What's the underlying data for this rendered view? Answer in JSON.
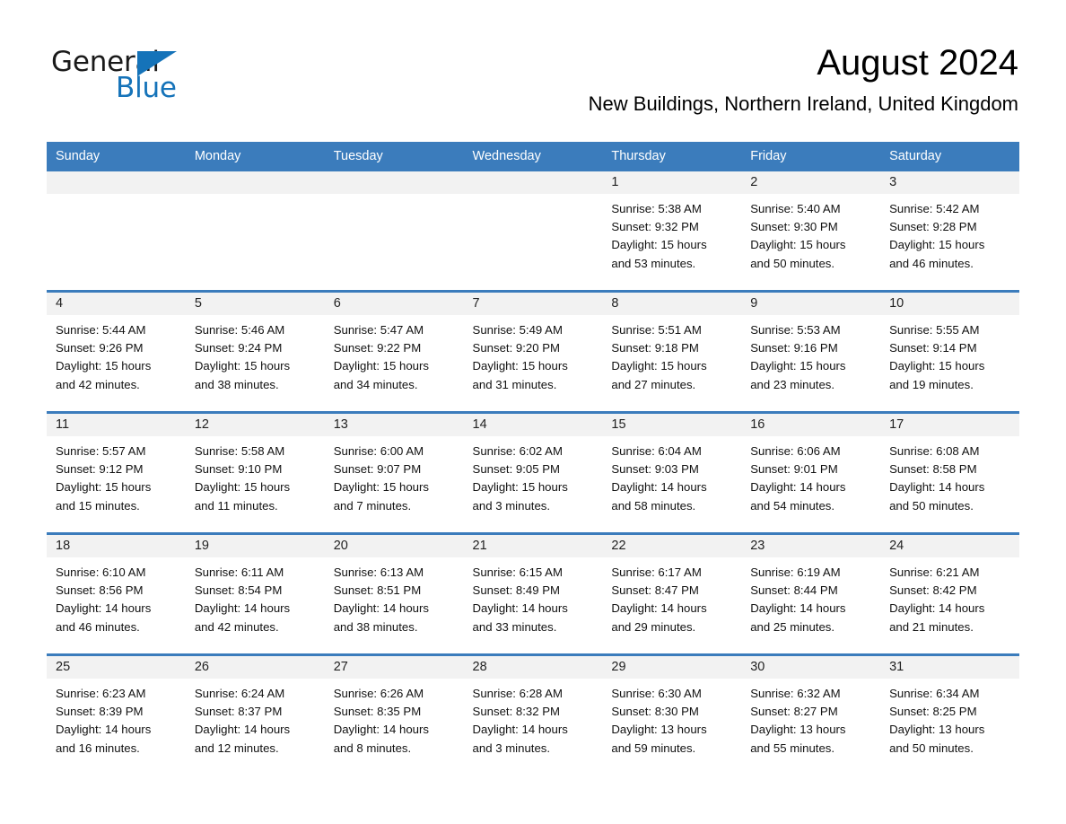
{
  "brand": {
    "name_part1": "General",
    "name_part2": "Blue",
    "triangle_icon": "triangle-icon",
    "accent_color": "#1573b9"
  },
  "header": {
    "month_title": "August 2024",
    "location": "New Buildings, Northern Ireland, United Kingdom"
  },
  "theme": {
    "header_row_bg": "#3b7cbc",
    "day_band_bg": "#f2f2f2",
    "cell_bg": "#ffffff",
    "row_divider": "#3b7cbc"
  },
  "weekday_headers": [
    "Sunday",
    "Monday",
    "Tuesday",
    "Wednesday",
    "Thursday",
    "Friday",
    "Saturday"
  ],
  "weeks": [
    {
      "days": [
        {
          "num": "",
          "empty": true,
          "sunrise": "",
          "sunset": "",
          "daylight_line1": "",
          "daylight_line2": ""
        },
        {
          "num": "",
          "empty": true,
          "sunrise": "",
          "sunset": "",
          "daylight_line1": "",
          "daylight_line2": ""
        },
        {
          "num": "",
          "empty": true,
          "sunrise": "",
          "sunset": "",
          "daylight_line1": "",
          "daylight_line2": ""
        },
        {
          "num": "",
          "empty": true,
          "sunrise": "",
          "sunset": "",
          "daylight_line1": "",
          "daylight_line2": ""
        },
        {
          "num": "1",
          "empty": false,
          "sunrise": "Sunrise: 5:38 AM",
          "sunset": "Sunset: 9:32 PM",
          "daylight_line1": "Daylight: 15 hours",
          "daylight_line2": "and 53 minutes."
        },
        {
          "num": "2",
          "empty": false,
          "sunrise": "Sunrise: 5:40 AM",
          "sunset": "Sunset: 9:30 PM",
          "daylight_line1": "Daylight: 15 hours",
          "daylight_line2": "and 50 minutes."
        },
        {
          "num": "3",
          "empty": false,
          "sunrise": "Sunrise: 5:42 AM",
          "sunset": "Sunset: 9:28 PM",
          "daylight_line1": "Daylight: 15 hours",
          "daylight_line2": "and 46 minutes."
        }
      ]
    },
    {
      "days": [
        {
          "num": "4",
          "empty": false,
          "sunrise": "Sunrise: 5:44 AM",
          "sunset": "Sunset: 9:26 PM",
          "daylight_line1": "Daylight: 15 hours",
          "daylight_line2": "and 42 minutes."
        },
        {
          "num": "5",
          "empty": false,
          "sunrise": "Sunrise: 5:46 AM",
          "sunset": "Sunset: 9:24 PM",
          "daylight_line1": "Daylight: 15 hours",
          "daylight_line2": "and 38 minutes."
        },
        {
          "num": "6",
          "empty": false,
          "sunrise": "Sunrise: 5:47 AM",
          "sunset": "Sunset: 9:22 PM",
          "daylight_line1": "Daylight: 15 hours",
          "daylight_line2": "and 34 minutes."
        },
        {
          "num": "7",
          "empty": false,
          "sunrise": "Sunrise: 5:49 AM",
          "sunset": "Sunset: 9:20 PM",
          "daylight_line1": "Daylight: 15 hours",
          "daylight_line2": "and 31 minutes."
        },
        {
          "num": "8",
          "empty": false,
          "sunrise": "Sunrise: 5:51 AM",
          "sunset": "Sunset: 9:18 PM",
          "daylight_line1": "Daylight: 15 hours",
          "daylight_line2": "and 27 minutes."
        },
        {
          "num": "9",
          "empty": false,
          "sunrise": "Sunrise: 5:53 AM",
          "sunset": "Sunset: 9:16 PM",
          "daylight_line1": "Daylight: 15 hours",
          "daylight_line2": "and 23 minutes."
        },
        {
          "num": "10",
          "empty": false,
          "sunrise": "Sunrise: 5:55 AM",
          "sunset": "Sunset: 9:14 PM",
          "daylight_line1": "Daylight: 15 hours",
          "daylight_line2": "and 19 minutes."
        }
      ]
    },
    {
      "days": [
        {
          "num": "11",
          "empty": false,
          "sunrise": "Sunrise: 5:57 AM",
          "sunset": "Sunset: 9:12 PM",
          "daylight_line1": "Daylight: 15 hours",
          "daylight_line2": "and 15 minutes."
        },
        {
          "num": "12",
          "empty": false,
          "sunrise": "Sunrise: 5:58 AM",
          "sunset": "Sunset: 9:10 PM",
          "daylight_line1": "Daylight: 15 hours",
          "daylight_line2": "and 11 minutes."
        },
        {
          "num": "13",
          "empty": false,
          "sunrise": "Sunrise: 6:00 AM",
          "sunset": "Sunset: 9:07 PM",
          "daylight_line1": "Daylight: 15 hours",
          "daylight_line2": "and 7 minutes."
        },
        {
          "num": "14",
          "empty": false,
          "sunrise": "Sunrise: 6:02 AM",
          "sunset": "Sunset: 9:05 PM",
          "daylight_line1": "Daylight: 15 hours",
          "daylight_line2": "and 3 minutes."
        },
        {
          "num": "15",
          "empty": false,
          "sunrise": "Sunrise: 6:04 AM",
          "sunset": "Sunset: 9:03 PM",
          "daylight_line1": "Daylight: 14 hours",
          "daylight_line2": "and 58 minutes."
        },
        {
          "num": "16",
          "empty": false,
          "sunrise": "Sunrise: 6:06 AM",
          "sunset": "Sunset: 9:01 PM",
          "daylight_line1": "Daylight: 14 hours",
          "daylight_line2": "and 54 minutes."
        },
        {
          "num": "17",
          "empty": false,
          "sunrise": "Sunrise: 6:08 AM",
          "sunset": "Sunset: 8:58 PM",
          "daylight_line1": "Daylight: 14 hours",
          "daylight_line2": "and 50 minutes."
        }
      ]
    },
    {
      "days": [
        {
          "num": "18",
          "empty": false,
          "sunrise": "Sunrise: 6:10 AM",
          "sunset": "Sunset: 8:56 PM",
          "daylight_line1": "Daylight: 14 hours",
          "daylight_line2": "and 46 minutes."
        },
        {
          "num": "19",
          "empty": false,
          "sunrise": "Sunrise: 6:11 AM",
          "sunset": "Sunset: 8:54 PM",
          "daylight_line1": "Daylight: 14 hours",
          "daylight_line2": "and 42 minutes."
        },
        {
          "num": "20",
          "empty": false,
          "sunrise": "Sunrise: 6:13 AM",
          "sunset": "Sunset: 8:51 PM",
          "daylight_line1": "Daylight: 14 hours",
          "daylight_line2": "and 38 minutes."
        },
        {
          "num": "21",
          "empty": false,
          "sunrise": "Sunrise: 6:15 AM",
          "sunset": "Sunset: 8:49 PM",
          "daylight_line1": "Daylight: 14 hours",
          "daylight_line2": "and 33 minutes."
        },
        {
          "num": "22",
          "empty": false,
          "sunrise": "Sunrise: 6:17 AM",
          "sunset": "Sunset: 8:47 PM",
          "daylight_line1": "Daylight: 14 hours",
          "daylight_line2": "and 29 minutes."
        },
        {
          "num": "23",
          "empty": false,
          "sunrise": "Sunrise: 6:19 AM",
          "sunset": "Sunset: 8:44 PM",
          "daylight_line1": "Daylight: 14 hours",
          "daylight_line2": "and 25 minutes."
        },
        {
          "num": "24",
          "empty": false,
          "sunrise": "Sunrise: 6:21 AM",
          "sunset": "Sunset: 8:42 PM",
          "daylight_line1": "Daylight: 14 hours",
          "daylight_line2": "and 21 minutes."
        }
      ]
    },
    {
      "days": [
        {
          "num": "25",
          "empty": false,
          "sunrise": "Sunrise: 6:23 AM",
          "sunset": "Sunset: 8:39 PM",
          "daylight_line1": "Daylight: 14 hours",
          "daylight_line2": "and 16 minutes."
        },
        {
          "num": "26",
          "empty": false,
          "sunrise": "Sunrise: 6:24 AM",
          "sunset": "Sunset: 8:37 PM",
          "daylight_line1": "Daylight: 14 hours",
          "daylight_line2": "and 12 minutes."
        },
        {
          "num": "27",
          "empty": false,
          "sunrise": "Sunrise: 6:26 AM",
          "sunset": "Sunset: 8:35 PM",
          "daylight_line1": "Daylight: 14 hours",
          "daylight_line2": "and 8 minutes."
        },
        {
          "num": "28",
          "empty": false,
          "sunrise": "Sunrise: 6:28 AM",
          "sunset": "Sunset: 8:32 PM",
          "daylight_line1": "Daylight: 14 hours",
          "daylight_line2": "and 3 minutes."
        },
        {
          "num": "29",
          "empty": false,
          "sunrise": "Sunrise: 6:30 AM",
          "sunset": "Sunset: 8:30 PM",
          "daylight_line1": "Daylight: 13 hours",
          "daylight_line2": "and 59 minutes."
        },
        {
          "num": "30",
          "empty": false,
          "sunrise": "Sunrise: 6:32 AM",
          "sunset": "Sunset: 8:27 PM",
          "daylight_line1": "Daylight: 13 hours",
          "daylight_line2": "and 55 minutes."
        },
        {
          "num": "31",
          "empty": false,
          "sunrise": "Sunrise: 6:34 AM",
          "sunset": "Sunset: 8:25 PM",
          "daylight_line1": "Daylight: 13 hours",
          "daylight_line2": "and 50 minutes."
        }
      ]
    }
  ]
}
